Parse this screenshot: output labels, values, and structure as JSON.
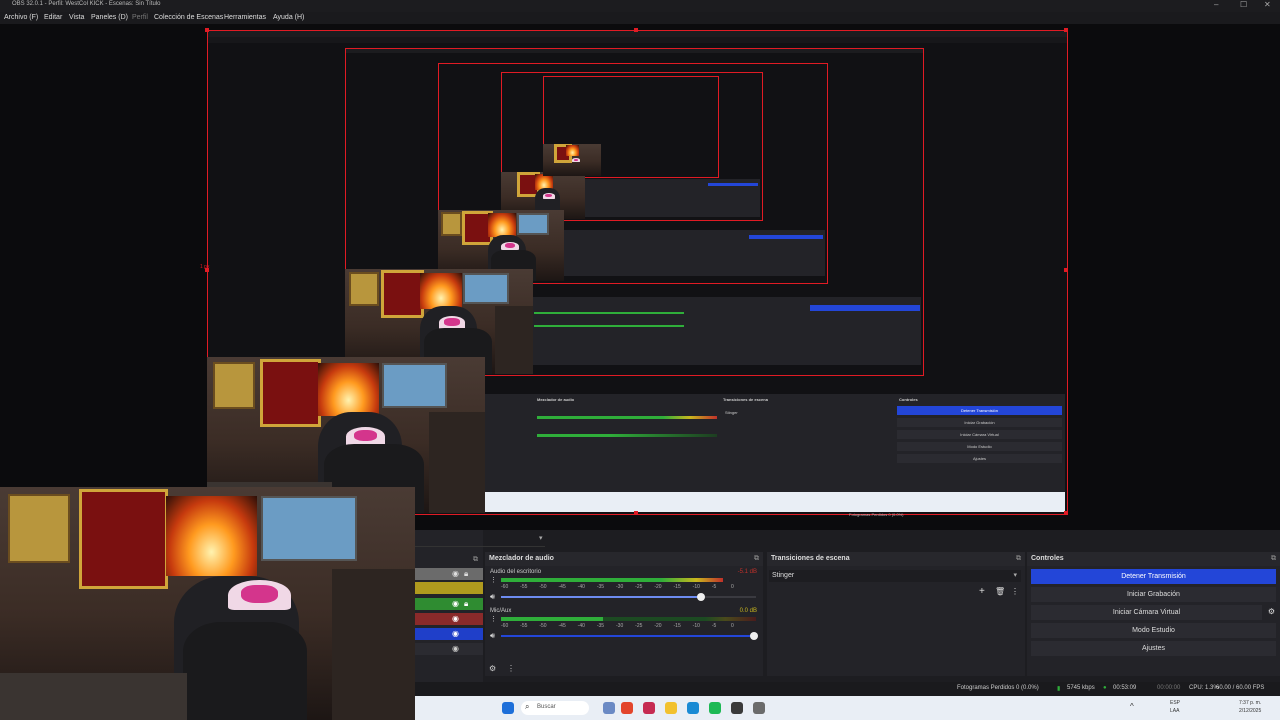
{
  "titlebar": {
    "title": "OBS 32.0.1 - Perfil: WestCol KICK - Escenas: Sin Título",
    "min": "–",
    "max": "☐",
    "close": "✕"
  },
  "menubar": {
    "items": [
      "Archivo (F)",
      "Editar",
      "Vista",
      "Paneles (D)",
      "Perfil",
      "Colección de Escenas",
      "Herramientas",
      "Ayuda (H)"
    ]
  },
  "preview": {
    "size_label": "1 px",
    "mini_dock": {
      "mixer_title": "Mezclador de audio",
      "transitions_title": "Transiciones de escena",
      "controls_title": "Controles",
      "stop_stream": "Detener Transmisión",
      "start_rec": "Iniciar Grabación",
      "virtual_cam": "Iniciar Cámara Virtual",
      "studio": "Modo Estudio",
      "settings": "Ajustes",
      "transition": "Stinger",
      "status": "Fotogramas Perdidos 0 (0.0%)"
    }
  },
  "mixer": {
    "title": "Mezclador de audio",
    "channels": [
      {
        "name": "Audio del escritorio",
        "db": "-5.1 dB",
        "level": 0.71
      },
      {
        "name": "Mic/Aux",
        "db": "0.0 dB",
        "level": 0.39
      }
    ],
    "ticks": [
      "-60",
      "-55",
      "-50",
      "-45",
      "-40",
      "-35",
      "-30",
      "-25",
      "-20",
      "-15",
      "-10",
      "-5",
      "0"
    ]
  },
  "transitions": {
    "title": "Transiciones de escena",
    "selected": "Stinger"
  },
  "controls": {
    "title": "Controles",
    "buttons": [
      "Detener Transmisión",
      "Iniciar Grabación",
      "Iniciar Cámara Virtual",
      "Modo Estudio",
      "Ajustes"
    ]
  },
  "statusbar": {
    "dropped": "Fotogramas Perdidos 0 (0.0%)",
    "bitrate": "5745 kbps",
    "stream_time": "00:53:09",
    "rec_time": "00:00:00",
    "cpu": "CPU: 1.3%",
    "fps": "60.00 / 60.00 FPS"
  },
  "taskbar": {
    "search_placeholder": "Buscar",
    "lang": "ESP",
    "lang2": "LAA",
    "time": "7:37 p. m.",
    "date": "2/12/2025"
  },
  "colors": {
    "accent_blue": "#2346d8",
    "selection_red": "#e01b24",
    "meter_green": "#2fae3a",
    "meter_yellow": "#c9b71e",
    "meter_red": "#c0302a"
  }
}
